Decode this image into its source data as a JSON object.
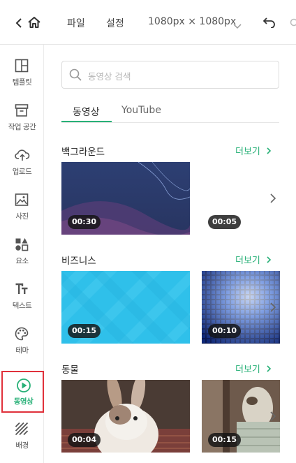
{
  "topbar": {
    "file_label": "파일",
    "settings_label": "설정",
    "size_label": "1080px × 1080px"
  },
  "sidebar": {
    "items": [
      {
        "label": "템플릿",
        "icon": "template-icon"
      },
      {
        "label": "작업 공간",
        "icon": "archive-icon"
      },
      {
        "label": "업로드",
        "icon": "cloud-upload-icon"
      },
      {
        "label": "사진",
        "icon": "photo-icon"
      },
      {
        "label": "요소",
        "icon": "elements-icon"
      },
      {
        "label": "텍스트",
        "icon": "text-icon"
      },
      {
        "label": "테마",
        "icon": "palette-icon"
      },
      {
        "label": "동영상",
        "icon": "play-circle-icon",
        "active": true
      },
      {
        "label": "배경",
        "icon": "background-icon"
      }
    ]
  },
  "search": {
    "placeholder": "동영상 검색"
  },
  "tabs": [
    {
      "label": "동영상",
      "active": true
    },
    {
      "label": "YouTube",
      "active": false
    }
  ],
  "sections": [
    {
      "title": "백그라운드",
      "more": "더보기",
      "videos": [
        {
          "duration": "00:30"
        },
        {
          "duration": "00:05"
        }
      ]
    },
    {
      "title": "비즈니스",
      "more": "더보기",
      "videos": [
        {
          "duration": "00:15"
        },
        {
          "duration": "00:10"
        }
      ]
    },
    {
      "title": "동물",
      "more": "더보기",
      "videos": [
        {
          "duration": "00:04"
        },
        {
          "duration": "00:15"
        }
      ]
    }
  ],
  "colors": {
    "accent": "#27b077",
    "highlight_border": "#e0313b"
  }
}
